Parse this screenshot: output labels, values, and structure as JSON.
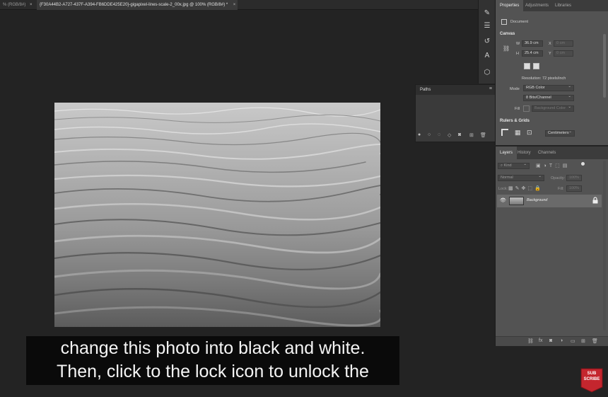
{
  "tabs": [
    {
      "label": "% (RGB/8#)",
      "close": "×"
    },
    {
      "label": "{F30A44B2-A727-437F-A394-FB6DDE425E20}-gigapixel-lines-scale-2_00x.jpg @ 100% (RGB/8#) *",
      "close": "×"
    }
  ],
  "paths_panel": {
    "title": "Paths",
    "menu": "≡"
  },
  "properties": {
    "tabs": [
      "Properties",
      "Adjustments",
      "Libraries"
    ],
    "document_label": "Document",
    "canvas": {
      "section": "Canvas",
      "w_label": "W",
      "w_value": "36.9 cm",
      "h_label": "H",
      "h_value": "25.4 cm",
      "x_label": "X",
      "x_value": "0 cm",
      "y_label": "Y",
      "y_value": "0 cm",
      "resolution": "Resolution: 72 pixels/inch",
      "mode_label": "Mode",
      "mode_value": "RGB Color",
      "depth_value": "8 Bits/Channel",
      "fill_label": "Fill",
      "fill_value": "Background Color"
    },
    "rulers": {
      "section": "Rulers & Grids",
      "units": "Centimeters"
    }
  },
  "layers": {
    "tabs": [
      "Layers",
      "History",
      "Channels"
    ],
    "kind_label": "Kind",
    "blend_mode": "Normal",
    "opacity_label": "Opacity:",
    "opacity_value": "100%",
    "lock_label": "Lock:",
    "fill_label": "Fill:",
    "fill_value": "100%",
    "items": [
      {
        "name": "Background",
        "visible": true,
        "locked": true
      }
    ]
  },
  "caption": {
    "line1": "change this photo into black and white.",
    "line2": "Then, click to the lock icon to unlock the"
  },
  "subscribe": {
    "line1": "SUB",
    "line2": "SCRIBE"
  },
  "colors": {
    "panel": "#535353",
    "app_bg": "#232323",
    "accent_red": "#c4262e"
  }
}
